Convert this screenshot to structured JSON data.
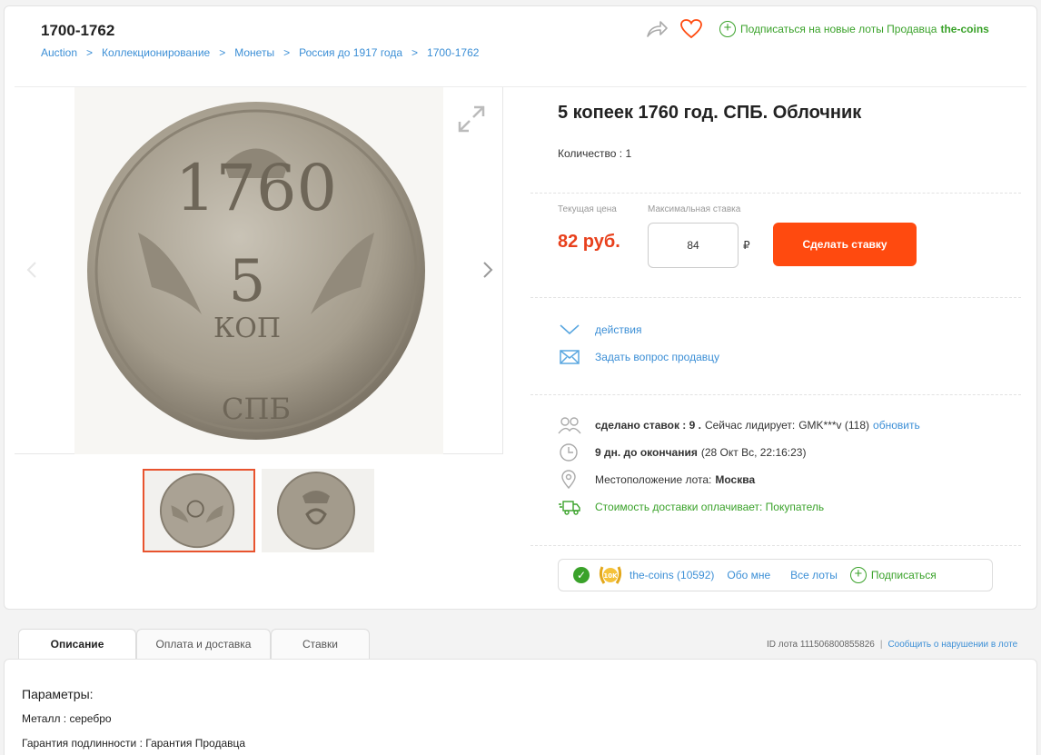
{
  "header": {
    "category_title": "1700-1762",
    "breadcrumb": [
      "Auction",
      "Коллекционирование",
      "Монеты",
      "Россия до 1917 года",
      "1700-1762"
    ],
    "subscribe_text": "Подписаться на новые лоты Продавца",
    "seller_name": "the-coins"
  },
  "lot": {
    "title": "5 копеек 1760 год. СПБ. Облочник",
    "quantity": "Количество : 1",
    "current_price_label": "Текущая цена",
    "current_price": "82 руб.",
    "max_bid_label": "Максимальная ставка",
    "max_bid_value": "84",
    "currency_sign": "₽",
    "bid_button": "Сделать ставку"
  },
  "actions": {
    "actions_label": "действия",
    "ask_seller": "Задать вопрос продавцу"
  },
  "info": {
    "bids_made": "сделано ставок : 9 .",
    "leader_prefix": "Сейчас лидирует:",
    "leader": "GMK***v (118)",
    "refresh": "обновить",
    "days_left": "9 дн. до окончания",
    "end_date": "(28 Окт Вс, 22:16:23)",
    "location_label": "Местоположение лота:",
    "location": "Москва",
    "shipping": "Стоимость доставки оплачивает: Покупатель"
  },
  "seller_box": {
    "badge": "10K",
    "name": "the-coins (10592)",
    "about": "Обо мне",
    "all_lots": "Все лоты",
    "subscribe": "Подписаться"
  },
  "tabs": [
    {
      "label": "Описание"
    },
    {
      "label": "Оплата и доставка"
    },
    {
      "label": "Ставки"
    }
  ],
  "lot_id": "ID лота 111506800855826",
  "report": "Сообщить о нарушении в лоте",
  "description": {
    "title": "Параметры:",
    "metal": "Металл : серебро",
    "guarantee": "Гарантия подлинности : Гарантия Продавца"
  },
  "coin_inscriptions": {
    "obverse_year": "1760",
    "obverse_value": "5",
    "obverse_unit": "КОП",
    "obverse_mint": "СПБ"
  },
  "colors": {
    "accent_orange": "#ff4a0f",
    "price_red": "#e8401c",
    "link_blue": "#3c8fd6",
    "green": "#3aa22a"
  }
}
